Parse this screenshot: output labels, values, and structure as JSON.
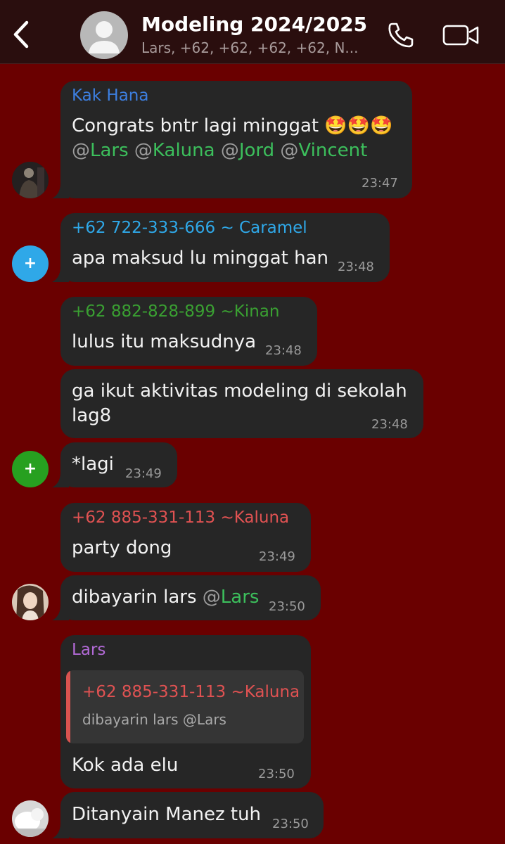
{
  "header": {
    "title": "Modeling 2024/2025",
    "subtitle": "Lars, +62, +62, +62, +62, N..."
  },
  "messages": [
    {
      "sender": "Kak Hana",
      "sender_color": "#3d7fe0",
      "line1": "Congrats bntr lagi minggat 🤩🤩🤩",
      "mentions": [
        "Lars",
        "Kaluna",
        "Jord",
        "Vincent"
      ],
      "time": "23:47"
    },
    {
      "sender": "+62 722-333-666 ~ Caramel",
      "sender_color": "#2fa8e8",
      "text": "apa maksud lu minggat han",
      "time": "23:48"
    },
    {
      "sender": "+62 882-828-899 ~Kinan",
      "sender_color": "#3aa032",
      "text": "lulus itu maksudnya",
      "time": "23:48"
    },
    {
      "line1": "ga ikut aktivitas modeling di sekolah",
      "line2": "lag8",
      "time": "23:48"
    },
    {
      "text": "*lagi",
      "time": "23:49"
    },
    {
      "sender": "+62 885-331-113 ~Kaluna",
      "sender_color": "#e05252",
      "text": "party dong",
      "time": "23:49"
    },
    {
      "text": "dibayarin lars",
      "mention": "Lars",
      "time": "23:50"
    },
    {
      "sender": "Lars",
      "sender_color": "#b26ad6",
      "quote_sender": "+62 885-331-113 ~Kaluna",
      "quote_text": "dibayarin lars @Lars",
      "text": "Kok ada elu",
      "time": "23:50"
    },
    {
      "text": "Ditanyain Manez tuh",
      "time": "23:50"
    }
  ],
  "avatars": {
    "plus_symbol": "+",
    "caramel_color": "#2fa8e8",
    "kinan_color": "#27a020"
  },
  "colors": {
    "background": "#6a0000",
    "header": "#2a0e0e",
    "bubble": "#262626",
    "mention": "#3cbf5c"
  }
}
